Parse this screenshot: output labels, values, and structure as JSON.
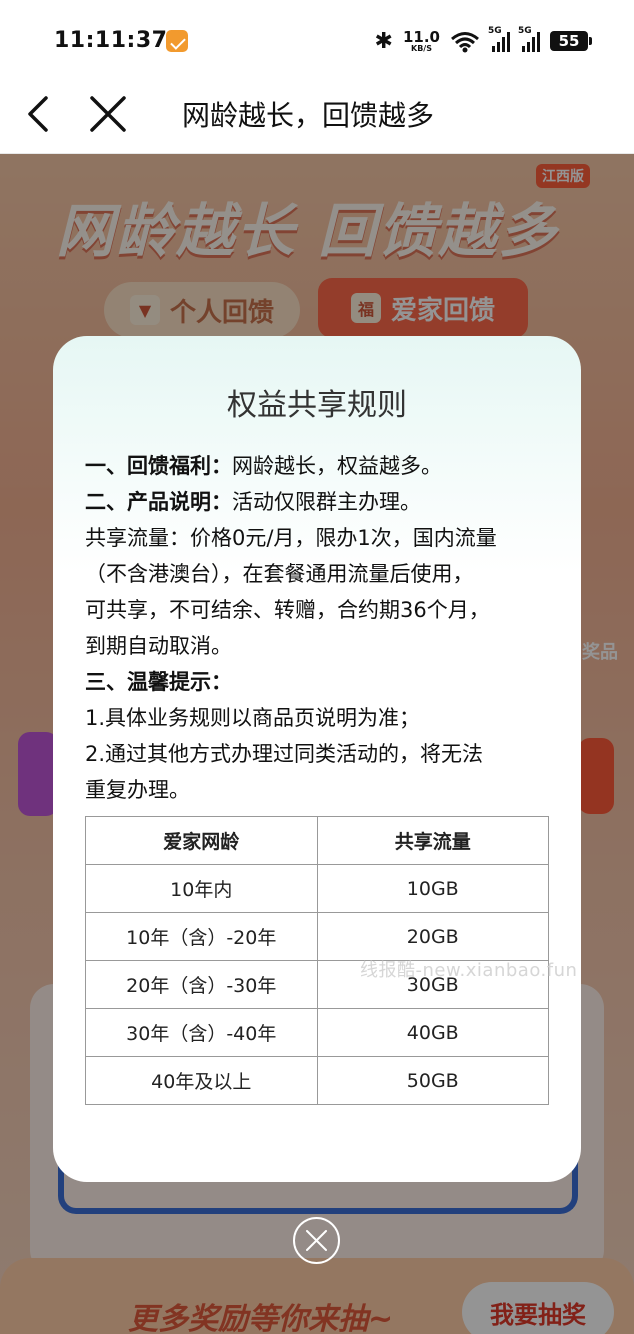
{
  "status_bar": {
    "time": "11:11:37",
    "net_speed_value": "11.0",
    "net_speed_unit": "KB/S",
    "signal_1_label": "5G",
    "signal_2_label": "5G",
    "battery": "55"
  },
  "nav": {
    "title": "网龄越长，回馈越多"
  },
  "background": {
    "banner_title": "网龄越长 回馈越多",
    "region": "江西版",
    "tab_personal": "个人回馈",
    "tab_family": "爱家回馈",
    "tab_family_icon": "福",
    "prize_text": "奖品",
    "bottom_text": "更多奖励等你来抽~",
    "draw_button": "我要抽奖"
  },
  "modal": {
    "title": "权益共享规则",
    "section1_head": "一、回馈福利：",
    "section1_body": "网龄越长，权益越多。",
    "section2_head": "二、产品说明：",
    "section2_body": "活动仅限群主办理。",
    "desc_line1": "共享流量：价格0元/月，限办1次，国内流量",
    "desc_line2": "（不含港澳台），在套餐通用流量后使用，",
    "desc_line3": "可共享，不可结余、转赠，合约期36个月，",
    "desc_line4": "到期自动取消。",
    "section3_head": "三、温馨提示：",
    "tip1": "1.具体业务规则以商品页说明为准；",
    "tip2_line1": "2.通过其他方式办理过同类活动的，将无法",
    "tip2_line2": "重复办理。",
    "table": {
      "headers": [
        "爱家网龄",
        "共享流量"
      ],
      "rows": [
        [
          "10年内",
          "10GB"
        ],
        [
          "10年（含）-20年",
          "20GB"
        ],
        [
          "20年（含）-30年",
          "30GB"
        ],
        [
          "30年（含）-40年",
          "40GB"
        ],
        [
          "40年及以上",
          "50GB"
        ]
      ]
    }
  },
  "watermark": "线报酷-new.xianbao.fun",
  "colors": {
    "accent": "#ff6a4a",
    "modal_tint": "#e6f7f4"
  }
}
